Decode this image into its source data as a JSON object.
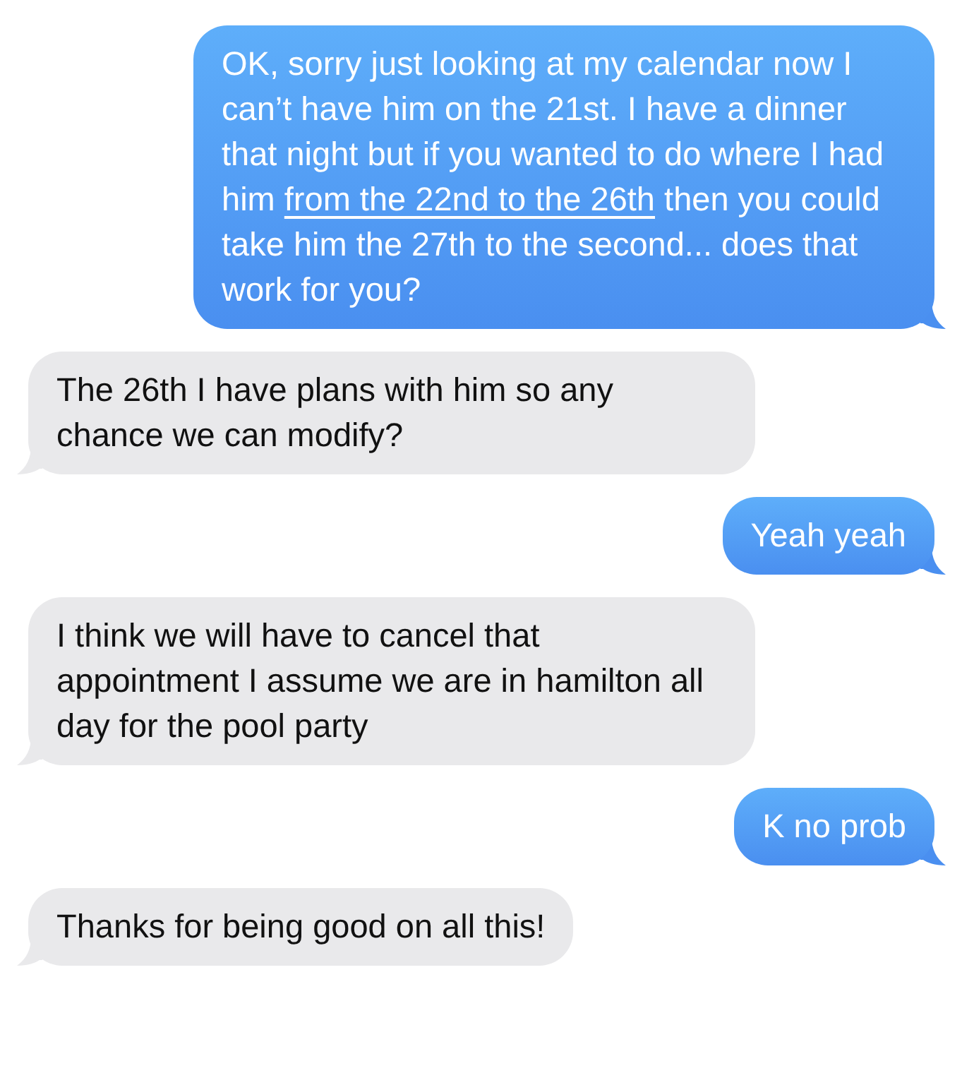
{
  "messages": [
    {
      "kind": "sent",
      "text_before": "OK, sorry just looking at my calendar now I can’t have him on the 21st. I have a dinner that night but if you wanted to do where I had him ",
      "link": "from the 22nd to the 26th",
      "text_after": " then you could take him the 27th to the second... does that work for you?"
    },
    {
      "kind": "received",
      "text_before": "The 26th I have plans with him so any chance we can modify?"
    },
    {
      "kind": "sent",
      "text_before": "Yeah yeah"
    },
    {
      "kind": "received",
      "text_before": "I think we will have to cancel that appointment I assume we are in hamilton all day for the pool party"
    },
    {
      "kind": "sent",
      "text_before": "K no prob"
    },
    {
      "kind": "received",
      "text_before": "Thanks for being good on all this!"
    }
  ]
}
